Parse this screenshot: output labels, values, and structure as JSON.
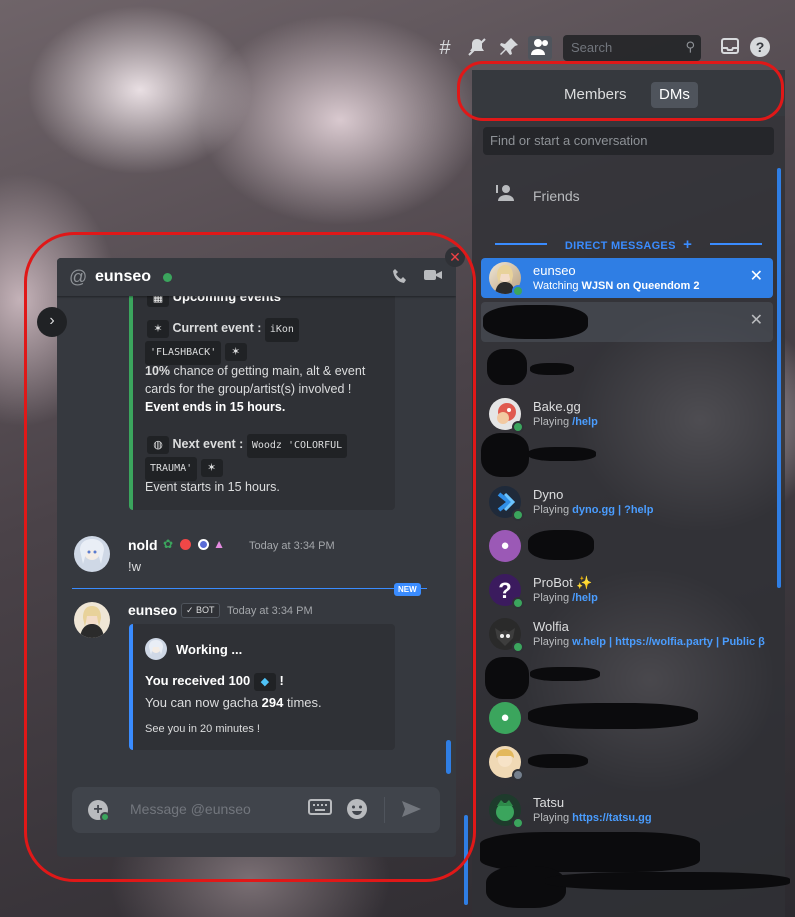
{
  "toolbar": {
    "icons": [
      "threads-icon",
      "mute-icon",
      "pin-icon",
      "members-icon"
    ],
    "search_placeholder": "Search",
    "right_icons": [
      "inbox-icon",
      "help-icon"
    ]
  },
  "sidebar": {
    "tabs": [
      {
        "label": "Members",
        "active": false
      },
      {
        "label": "DMs",
        "active": true
      }
    ],
    "search_placeholder": "Find or start a conversation",
    "friends_label": "Friends",
    "section_header": "DIRECT MESSAGES",
    "dms": [
      {
        "name": "eunseo",
        "status_prefix": "Watching",
        "status_bold": "WJSN on Queendom 2",
        "selected": true
      },
      {
        "name": "Bake.gg",
        "status_prefix": "Playing",
        "status_bold": "/help"
      },
      {
        "name": "Dyno",
        "status_prefix": "Playing",
        "status_bold": "dyno.gg | ?help"
      },
      {
        "name": "ProBot ✨",
        "status_prefix": "Playing",
        "status_bold": "/help"
      },
      {
        "name": "Wolfia",
        "status_prefix": "Playing",
        "status_bold": "w.help | https://wolfia.party | Public β"
      },
      {
        "name": "Tatsu",
        "status_prefix": "Playing",
        "status_bold": "https://tatsu.gg"
      }
    ]
  },
  "chat": {
    "recipient": "eunseo",
    "top_embed": {
      "partial_title": "Upcoming events",
      "current_event_label": "Current event :",
      "current_event_code1": "iKon",
      "current_event_code2": "'FLASHBACK'",
      "chance_bold": "10%",
      "chance_text": " chance of getting main, alt & event cards for the group/artist(s) involved !",
      "ends_text": "Event ends in 15 hours.",
      "next_event_label": "Next event :",
      "next_event_code1": "Woodz 'COLORFUL",
      "next_event_code2": "TRAUMA'",
      "starts_text": "Event starts in 15 hours."
    },
    "messages": [
      {
        "author": "nold",
        "time": "Today at 3:34 PM",
        "text": "!w"
      },
      {
        "author": "eunseo",
        "badge": "✓ BOT",
        "time": "Today at 3:34 PM"
      }
    ],
    "new_label": "NEW",
    "bot_embed": {
      "title": "Working ...",
      "received_bold": "You received 100",
      "received_end": "!",
      "gacha_pre": "You can now gacha ",
      "gacha_count": "294",
      "gacha_post": " times.",
      "footer": "See you in 20 minutes !"
    },
    "composer_placeholder": "Message @eunseo"
  },
  "colors": {
    "accent": "#2f7ee4",
    "online": "#3ba55d",
    "annotation": "#e01818",
    "embed_bar_green": "#3ba55d",
    "embed_bar_blue": "#3a8cff"
  }
}
